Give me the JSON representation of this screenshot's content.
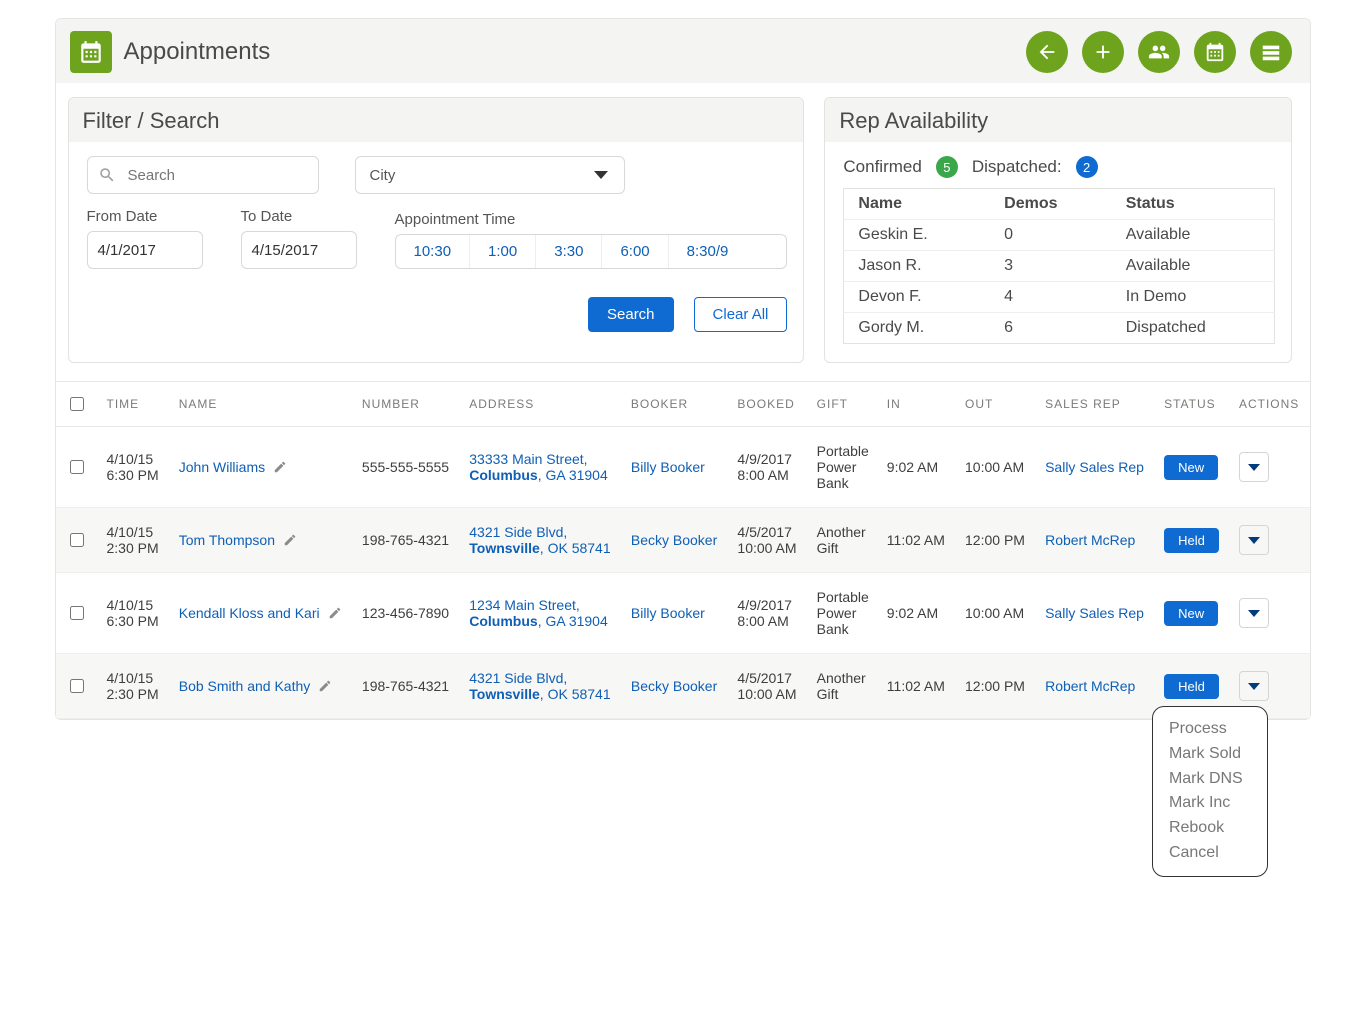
{
  "header": {
    "title": "Appointments"
  },
  "filter": {
    "panel_title": "Filter / Search",
    "search_placeholder": "Search",
    "city_label": "City",
    "from_label": "From Date",
    "to_label": "To Date",
    "from_date": "4/1/2017",
    "to_date": "4/15/2017",
    "time_label": "Appointment Time",
    "times": [
      "10:30",
      "1:00",
      "3:30",
      "6:00",
      "8:30/9"
    ],
    "search_btn": "Search",
    "clear_btn": "Clear All"
  },
  "availability": {
    "panel_title": "Rep Availability",
    "confirmed_label": "Confirmed",
    "confirmed_count": "5",
    "dispatched_label": "Dispatched:",
    "dispatched_count": "2",
    "columns": [
      "Name",
      "Demos",
      "Status"
    ],
    "rows": [
      {
        "name": "Geskin E.",
        "demos": "0",
        "status": "Available"
      },
      {
        "name": "Jason R.",
        "demos": "3",
        "status": "Available"
      },
      {
        "name": "Devon F.",
        "demos": "4",
        "status": "In Demo"
      },
      {
        "name": "Gordy M.",
        "demos": "6",
        "status": "Dispatched"
      }
    ]
  },
  "grid": {
    "columns": [
      "TIME",
      "NAME",
      "NUMBER",
      "ADDRESS",
      "BOOKER",
      "BOOKED",
      "GIFT",
      "IN",
      "OUT",
      "SALES REP",
      "STATUS",
      "ACTIONS"
    ],
    "rows": [
      {
        "time": "4/10/15 6:30 PM",
        "name": "John Williams",
        "number": "555-555-5555",
        "address_l1": "33333 Main Street,",
        "address_city": "Columbus",
        "address_rest": ", GA 31904",
        "booker": "Billy Booker",
        "booked": "4/9/2017 8:00 AM",
        "gift": "Portable Power Bank",
        "in": "9:02 AM",
        "out": "10:00 AM",
        "rep": "Sally Sales Rep",
        "status": "New"
      },
      {
        "time": "4/10/15 2:30 PM",
        "name": "Tom Thompson",
        "number": "198-765-4321",
        "address_l1": "4321 Side Blvd,",
        "address_city": "Townsville",
        "address_rest": ", OK 58741",
        "booker": "Becky Booker",
        "booked": "4/5/2017 10:00 AM",
        "gift": "Another Gift",
        "in": "11:02 AM",
        "out": "12:00 PM",
        "rep": "Robert McRep",
        "status": "Held"
      },
      {
        "time": "4/10/15 6:30 PM",
        "name": "Kendall Kloss and Kari",
        "number": "123-456-7890",
        "address_l1": "1234 Main Street,",
        "address_city": "Columbus",
        "address_rest": ", GA 31904",
        "booker": "Billy Booker",
        "booked": "4/9/2017 8:00 AM",
        "gift": "Portable Power Bank",
        "in": "9:02 AM",
        "out": "10:00 AM",
        "rep": "Sally Sales Rep",
        "status": "New"
      },
      {
        "time": "4/10/15 2:30 PM",
        "name": "Bob Smith and Kathy",
        "number": "198-765-4321",
        "address_l1": "4321 Side Blvd,",
        "address_city": "Townsville",
        "address_rest": ", OK 58741",
        "booker": "Becky Booker",
        "booked": "4/5/2017 10:00 AM",
        "gift": "Another Gift",
        "in": "11:02 AM",
        "out": "12:00 PM",
        "rep": "Robert McRep",
        "status": "Held"
      }
    ]
  },
  "actions_menu": [
    "Process",
    "Mark Sold",
    "Mark DNS",
    "Mark Inc",
    "Rebook",
    "Cancel"
  ]
}
